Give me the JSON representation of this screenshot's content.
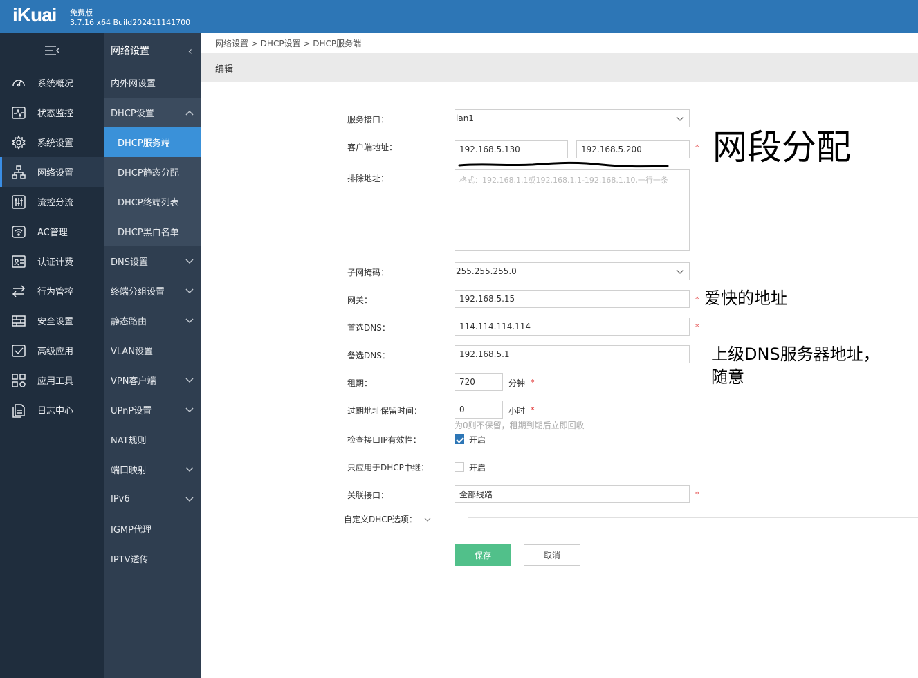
{
  "header": {
    "logo": "iKuai",
    "edition": "免费版",
    "version": "3.7.16 x64 Build202411141700"
  },
  "nav_primary": [
    {
      "label": "系统概况",
      "icon": "dashboard-icon"
    },
    {
      "label": "状态监控",
      "icon": "monitor-icon"
    },
    {
      "label": "系统设置",
      "icon": "gear-icon"
    },
    {
      "label": "网络设置",
      "icon": "network-icon"
    },
    {
      "label": "流控分流",
      "icon": "sliders-icon"
    },
    {
      "label": "AC管理",
      "icon": "wifi-icon"
    },
    {
      "label": "认证计费",
      "icon": "auth-icon"
    },
    {
      "label": "行为管控",
      "icon": "arrows-icon"
    },
    {
      "label": "安全设置",
      "icon": "shield-icon"
    },
    {
      "label": "高级应用",
      "icon": "advanced-icon"
    },
    {
      "label": "应用工具",
      "icon": "tools-icon"
    },
    {
      "label": "日志中心",
      "icon": "log-icon"
    }
  ],
  "nav_secondary": {
    "title": "网络设置",
    "items": [
      {
        "label": "内外网设置"
      },
      {
        "label": "DHCP设置"
      },
      {
        "label": "DHCP服务端"
      },
      {
        "label": "DHCP静态分配"
      },
      {
        "label": "DHCP终端列表"
      },
      {
        "label": "DHCP黑白名单"
      },
      {
        "label": "DNS设置"
      },
      {
        "label": "终端分组设置"
      },
      {
        "label": "静态路由"
      },
      {
        "label": "VLAN设置"
      },
      {
        "label": "VPN客户端"
      },
      {
        "label": "UPnP设置"
      },
      {
        "label": "NAT规则"
      },
      {
        "label": "端口映射"
      },
      {
        "label": "IPv6"
      },
      {
        "label": "IGMP代理"
      },
      {
        "label": "IPTV透传"
      }
    ]
  },
  "breadcrumb": "网络设置 > DHCP设置 > DHCP服务端",
  "edit_title": "编辑",
  "form": {
    "interface_label": "服务接口：",
    "interface_value": "lan1",
    "client_addr_label": "客户端地址：",
    "client_addr_start": "192.168.5.130",
    "client_addr_sep": "-",
    "client_addr_end": "192.168.5.200",
    "exclude_label": "排除地址：",
    "exclude_placeholder": "格式：192.168.1.1或192.168.1.1-192.168.1.10,一行一条",
    "netmask_label": "子网掩码：",
    "netmask_value": "255.255.255.0",
    "gateway_label": "网关：",
    "gateway_value": "192.168.5.15",
    "dns1_label": "首选DNS：",
    "dns1_value": "114.114.114.114",
    "dns2_label": "备选DNS：",
    "dns2_value": "192.168.5.1",
    "lease_label": "租期：",
    "lease_value": "720",
    "lease_unit": "分钟",
    "expire_label": "过期地址保留时间：",
    "expire_value": "0",
    "expire_unit": "小时",
    "expire_hint": "为0则不保留，租期到期后立即回收",
    "check_ip_label": "检查接口IP有效性：",
    "check_ip_option": "开启",
    "check_ip_checked": true,
    "relay_label": "只应用于DHCP中继：",
    "relay_option": "开启",
    "relay_checked": false,
    "link_iface_label": "关联接口：",
    "link_iface_value": "全部线路",
    "custom_options_label": "自定义DHCP选项：",
    "required_mark": "*"
  },
  "buttons": {
    "save": "保存",
    "cancel": "取消"
  },
  "annotations": {
    "segment": "网段分配",
    "gateway_note": "爱快的地址",
    "dns_note_line1": "上级DNS服务器地址，",
    "dns_note_line2": "随意"
  },
  "colors": {
    "header_bg": "#2d76b6",
    "nav_primary_bg": "#1f2d3d",
    "nav_secondary_bg": "#2f3e50",
    "nav_active": "#3a91d9",
    "save_button": "#51c08a",
    "required": "#e03030"
  }
}
